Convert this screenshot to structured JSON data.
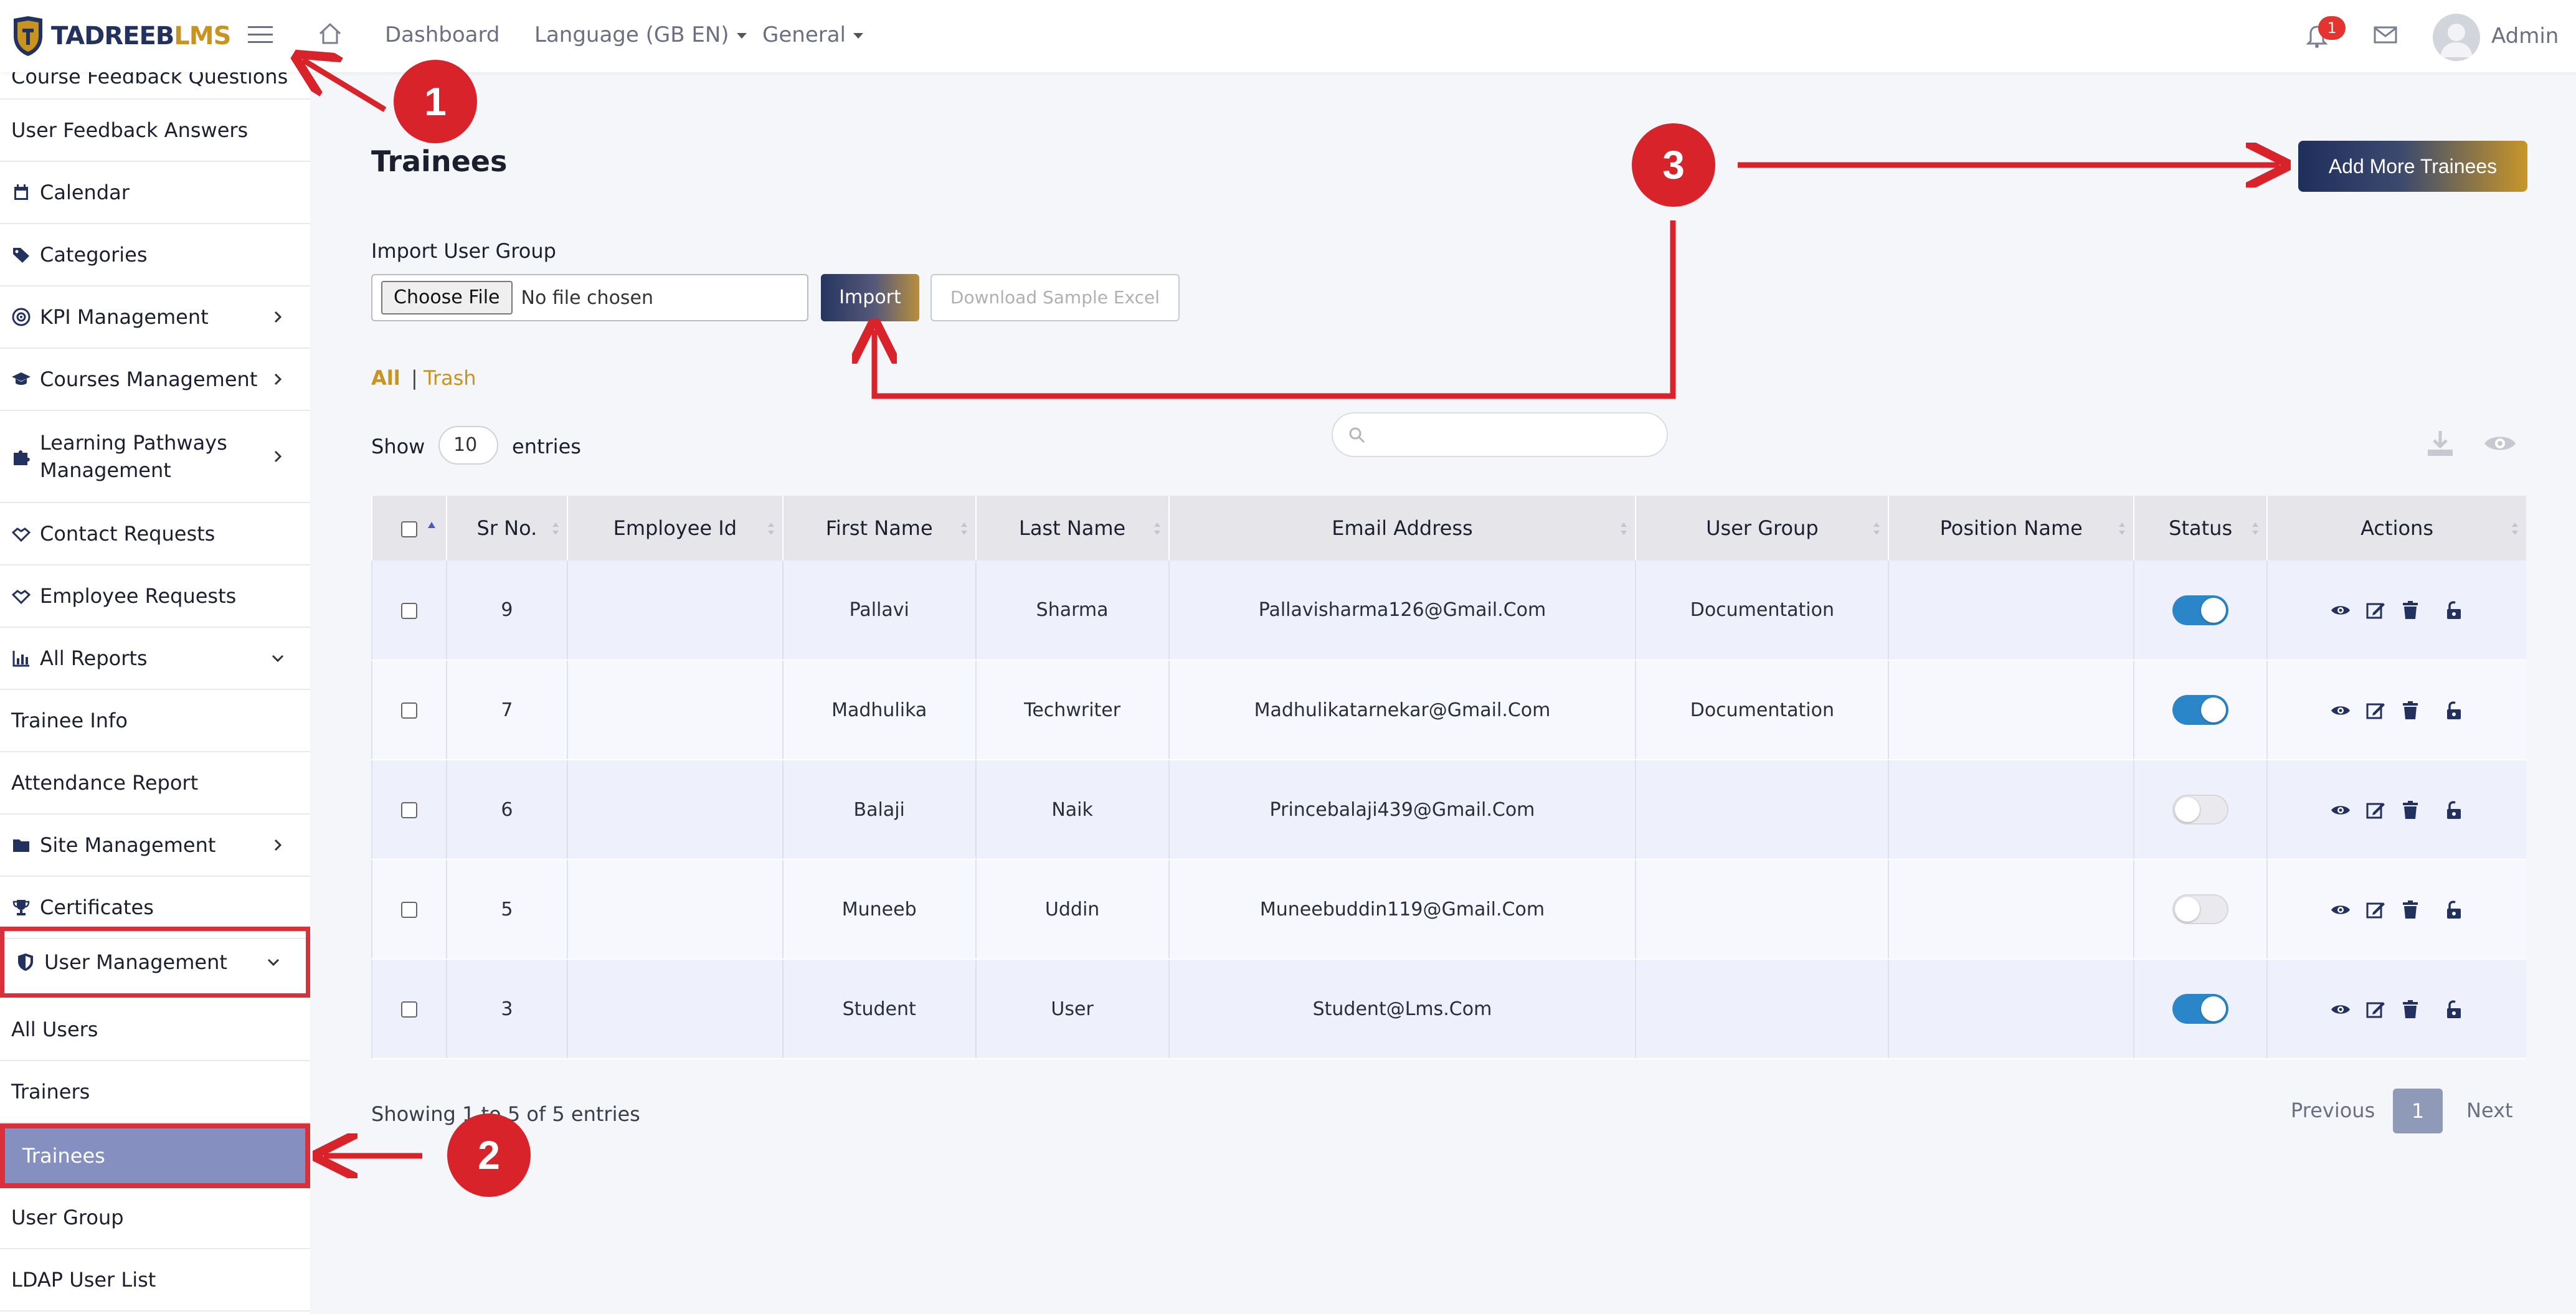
{
  "header": {
    "logo_part1": "TADREEB",
    "logo_part2": "LMS",
    "nav_dashboard": "Dashboard",
    "nav_language": "Language (GB EN)",
    "nav_general": "General",
    "notification_count": "1",
    "user_name": "Admin"
  },
  "sidebar": {
    "items": [
      {
        "label": "Course Feedback Questions"
      },
      {
        "label": "User Feedback Answers"
      },
      {
        "label": "Calendar",
        "icon": "calendar-icon"
      },
      {
        "label": "Categories",
        "icon": "tags-icon"
      },
      {
        "label": "KPI Management",
        "icon": "target-icon"
      },
      {
        "label": "Courses Management",
        "icon": "graduation-cap-icon"
      },
      {
        "label": "Learning Pathways Management",
        "icon": "puzzle-icon"
      },
      {
        "label": "Contact Requests",
        "icon": "handshake-icon"
      },
      {
        "label": "Employee Requests",
        "icon": "handshake-icon"
      },
      {
        "label": "All Reports",
        "icon": "bar-chart-icon"
      },
      {
        "label": "Trainee Info"
      },
      {
        "label": "Attendance Report"
      },
      {
        "label": "Site Management",
        "icon": "folder-icon"
      },
      {
        "label": "Certificates",
        "icon": "trophy-icon"
      },
      {
        "label": "User Management",
        "icon": "shield-icon"
      },
      {
        "label": "All Users"
      },
      {
        "label": "Trainers"
      },
      {
        "label": "Trainees"
      },
      {
        "label": "User Group"
      },
      {
        "label": "LDAP User List"
      }
    ]
  },
  "main": {
    "title": "Trainees",
    "add_button": "Add More Trainees",
    "import_label": "Import User Group",
    "choose_file": "Choose File",
    "no_file": "No file chosen",
    "import_button": "Import",
    "sample_button": "Download Sample Excel",
    "filter_all": "All",
    "filter_sep": "|",
    "filter_trash": "Trash",
    "show_label": "Show",
    "entries_value": "10",
    "entries_label": "entries",
    "showing_text": "Showing 1 to 5 of 5 entries",
    "pagination": {
      "previous": "Previous",
      "current": "1",
      "next": "Next"
    }
  },
  "table": {
    "columns": [
      "Sr No.",
      "Employee Id",
      "First Name",
      "Last Name",
      "Email Address",
      "User Group",
      "Position Name",
      "Status",
      "Actions"
    ],
    "rows": [
      {
        "sr": "9",
        "employee_id": "",
        "first": "Pallavi",
        "last": "Sharma",
        "email": "Pallavisharma126@Gmail.Com",
        "group": "Documentation",
        "position": "",
        "status": true
      },
      {
        "sr": "7",
        "employee_id": "",
        "first": "Madhulika",
        "last": "Techwriter",
        "email": "Madhulikatarnekar@Gmail.Com",
        "group": "Documentation",
        "position": "",
        "status": true
      },
      {
        "sr": "6",
        "employee_id": "",
        "first": "Balaji",
        "last": "Naik",
        "email": "Princebalaji439@Gmail.Com",
        "group": "",
        "position": "",
        "status": false
      },
      {
        "sr": "5",
        "employee_id": "",
        "first": "Muneeb",
        "last": "Uddin",
        "email": "Muneebuddin119@Gmail.Com",
        "group": "",
        "position": "",
        "status": false
      },
      {
        "sr": "3",
        "employee_id": "",
        "first": "Student",
        "last": "User",
        "email": "Student@Lms.Com",
        "group": "",
        "position": "",
        "status": true
      }
    ]
  },
  "annotations": [
    "1",
    "2",
    "3"
  ],
  "colors": {
    "brand_navy": "#22315e",
    "brand_gold": "#c9931f",
    "annotation_red": "#d8232a",
    "toggle_on": "#2a86c8",
    "active_item": "#8590c0"
  }
}
